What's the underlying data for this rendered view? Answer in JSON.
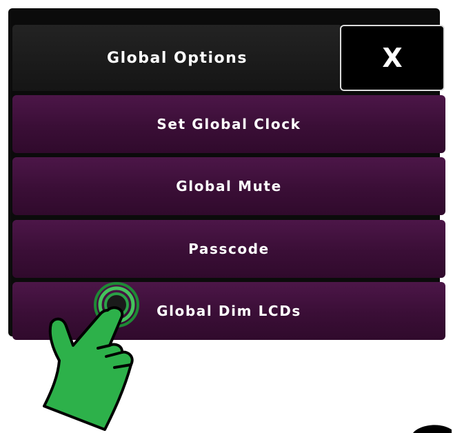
{
  "dialog": {
    "title": "Global Options",
    "close_label": "X"
  },
  "menu": {
    "items": [
      {
        "label": "Set Global Clock"
      },
      {
        "label": "Global Mute"
      },
      {
        "label": "Passcode"
      },
      {
        "label": "Global Dim LCDs"
      }
    ]
  },
  "overlay": {
    "pointer_icon": "pointing-hand-icon",
    "tap_indicator": "tap-ripple-icon",
    "accent_color": "#2db14a",
    "button_color": "#3d0f39",
    "panel_color": "#0b0b0b"
  }
}
